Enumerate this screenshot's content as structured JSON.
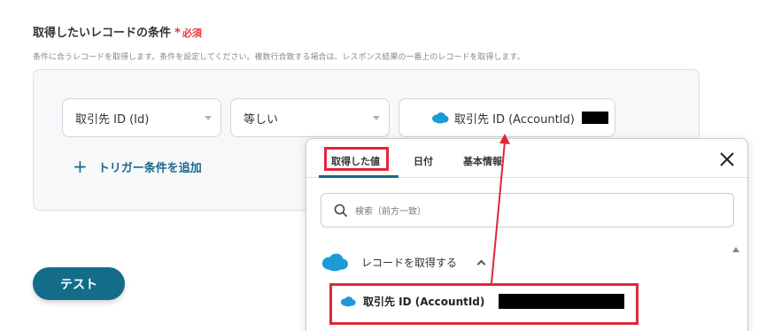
{
  "section": {
    "title": "取得したいレコードの条件",
    "required_mark": "*",
    "required_text": "必須",
    "description": "条件に合うレコードを取得します。条件を設定してください。複数行合致する場合は、レスポンス結果の一番上のレコードを取得します。"
  },
  "condition": {
    "field_value": "取引先 ID (Id)",
    "operator_value": "等しい",
    "value_chip_label": "取引先 ID (AccountId)",
    "add_condition_label": "トリガー条件を追加"
  },
  "test_button_label": "テスト",
  "popup": {
    "tabs": [
      {
        "label": "取得した値"
      },
      {
        "label": "日付"
      },
      {
        "label": "基本情報"
      }
    ],
    "search_placeholder": "検索（前方一致）",
    "group_label": "レコードを取得する",
    "result_item_label": "取引先 ID (AccountId)"
  },
  "colors": {
    "accent": "#136c88",
    "highlight": "#e0263a",
    "required": "#e0383e",
    "salesforce": "#1b9ad6"
  },
  "icons": [
    "plus-icon",
    "caret-down-icon",
    "salesforce-cloud-icon",
    "close-icon",
    "search-icon",
    "chevron-up-icon",
    "scroll-up-icon"
  ]
}
